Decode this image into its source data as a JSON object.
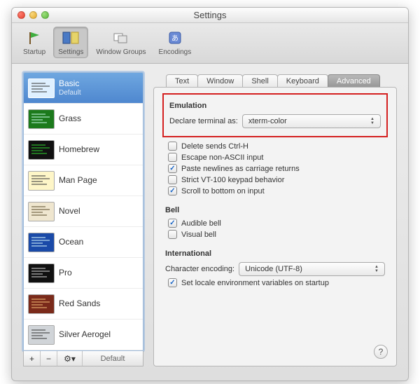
{
  "window": {
    "title": "Settings"
  },
  "toolbar": {
    "items": [
      {
        "label": "Startup"
      },
      {
        "label": "Settings"
      },
      {
        "label": "Window Groups"
      },
      {
        "label": "Encodings"
      }
    ]
  },
  "sidebar": {
    "profiles": [
      {
        "name": "Basic",
        "sub": "Default",
        "selected": true,
        "bg": "#dff0ff",
        "fg": "#333"
      },
      {
        "name": "Grass",
        "bg": "#1c7a1c",
        "fg": "#cfe"
      },
      {
        "name": "Homebrew",
        "bg": "#111",
        "fg": "#2fd62f"
      },
      {
        "name": "Man Page",
        "bg": "#fef6c8",
        "fg": "#333"
      },
      {
        "name": "Novel",
        "bg": "#efe6cf",
        "fg": "#5a4a2a"
      },
      {
        "name": "Ocean",
        "bg": "#1a4aa8",
        "fg": "#dff"
      },
      {
        "name": "Pro",
        "bg": "#111",
        "fg": "#ddd"
      },
      {
        "name": "Red Sands",
        "bg": "#7a2a1a",
        "fg": "#f7c27a"
      },
      {
        "name": "Silver Aerogel",
        "bg": "#d0d4d8",
        "fg": "#333"
      }
    ],
    "footer": {
      "add": "+",
      "remove": "−",
      "gear": "⚙▾",
      "default_label": "Default"
    }
  },
  "tabs": {
    "items": [
      "Text",
      "Window",
      "Shell",
      "Keyboard",
      "Advanced"
    ],
    "selected": "Advanced"
  },
  "emulation": {
    "title": "Emulation",
    "declare_label": "Declare terminal as:",
    "declare_value": "xterm-color",
    "opts": [
      {
        "label": "Delete sends Ctrl-H",
        "checked": false
      },
      {
        "label": "Escape non-ASCII input",
        "checked": false
      },
      {
        "label": "Paste newlines as carriage returns",
        "checked": true
      },
      {
        "label": "Strict VT-100 keypad behavior",
        "checked": false
      },
      {
        "label": "Scroll to bottom on input",
        "checked": true
      }
    ]
  },
  "bell": {
    "title": "Bell",
    "opts": [
      {
        "label": "Audible bell",
        "checked": true
      },
      {
        "label": "Visual bell",
        "checked": false
      }
    ]
  },
  "intl": {
    "title": "International",
    "encoding_label": "Character encoding:",
    "encoding_value": "Unicode (UTF-8)",
    "setlocale": {
      "label": "Set locale environment variables on startup",
      "checked": true
    }
  },
  "help": "?"
}
